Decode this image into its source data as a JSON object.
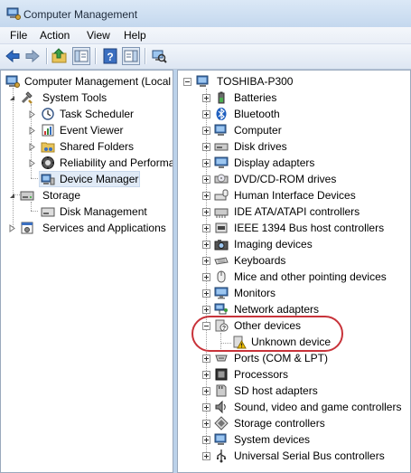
{
  "window": {
    "title": "Computer Management"
  },
  "menu": [
    "File",
    "Action",
    "View",
    "Help"
  ],
  "toolbar": {
    "buttons": [
      {
        "icon": "back-arrow-icon"
      },
      {
        "icon": "forward-arrow-icon"
      },
      {
        "icon": "up-folder-icon"
      },
      {
        "icon": "show-hide-tree-icon"
      },
      {
        "icon": "help-icon"
      },
      {
        "icon": "show-hide-action-pane-icon"
      },
      {
        "icon": "scan-hardware-icon"
      }
    ]
  },
  "left_tree": {
    "root": "Computer Management (Local",
    "system_tools": "System Tools",
    "task_scheduler": "Task Scheduler",
    "event_viewer": "Event Viewer",
    "shared_folders": "Shared Folders",
    "reliability": "Reliability and Performa",
    "device_manager": "Device Manager",
    "storage": "Storage",
    "disk_management": "Disk Management",
    "services": "Services and Applications"
  },
  "device_tree": {
    "computer": "TOSHIBA-P300",
    "categories": [
      "Batteries",
      "Bluetooth",
      "Computer",
      "Disk drives",
      "Display adapters",
      "DVD/CD-ROM drives",
      "Human Interface Devices",
      "IDE ATA/ATAPI controllers",
      "IEEE 1394 Bus host controllers",
      "Imaging devices",
      "Keyboards",
      "Mice and other pointing devices",
      "Monitors",
      "Network adapters",
      "Other devices",
      "Unknown device",
      "Ports (COM & LPT)",
      "Processors",
      "SD host adapters",
      "Sound, video and game controllers",
      "Storage controllers",
      "System devices",
      "Universal Serial Bus controllers"
    ]
  },
  "colors": {
    "annotation": "#c8333a",
    "selection": "#e0eaf6",
    "chrome": "#bcd2ea"
  }
}
